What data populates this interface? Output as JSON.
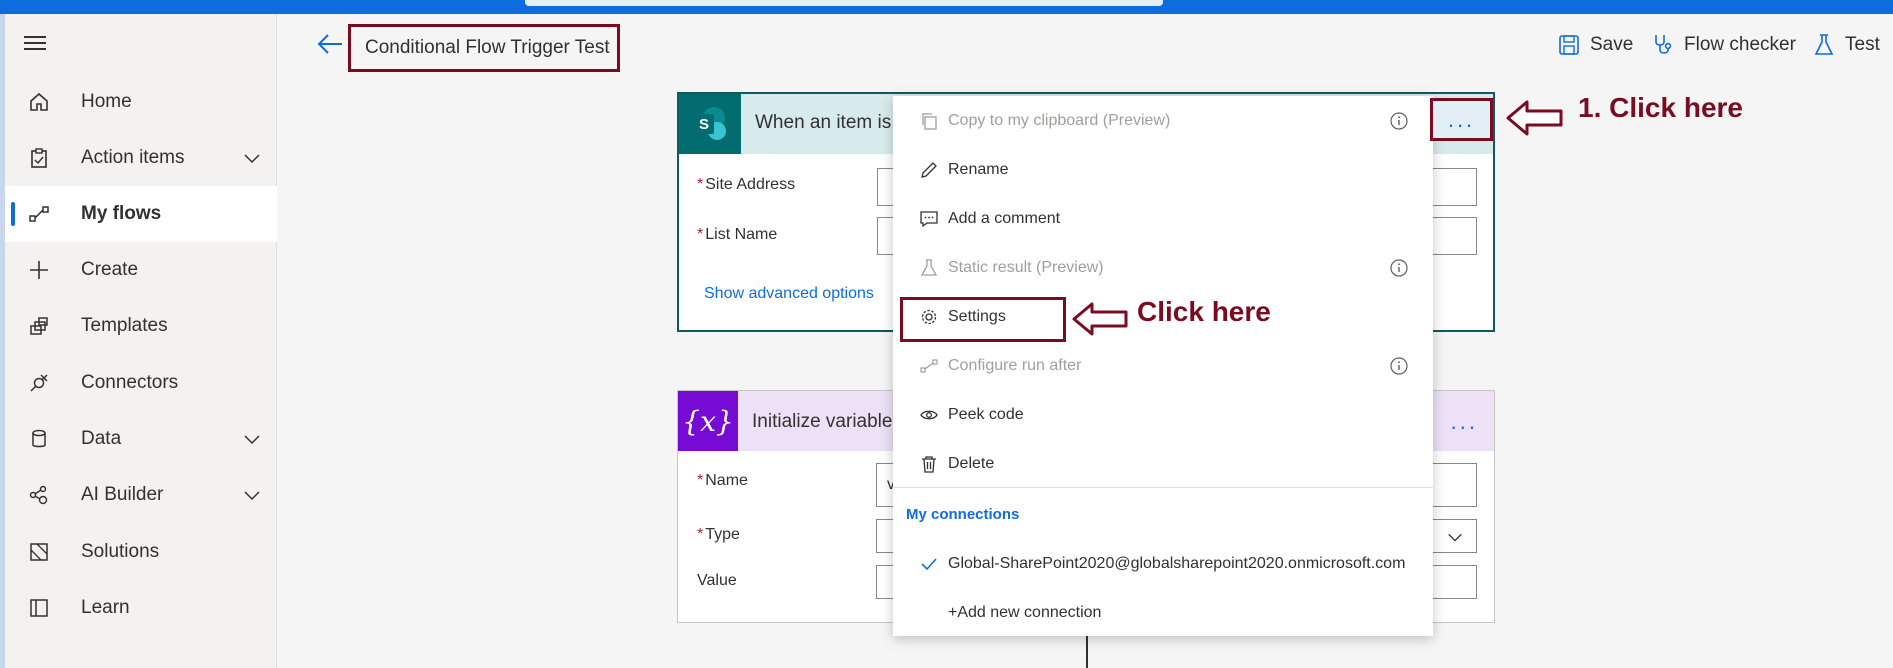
{
  "app": {
    "flow_title": "Conditional Flow Trigger Test"
  },
  "colors": {
    "brand_blue": "#0f6cdd",
    "annotation": "#7a0b20",
    "sharepoint_teal": "#036c70",
    "variable_purple": "#770bd6"
  },
  "sidebar": {
    "items": [
      {
        "label": "Home",
        "icon": "home-icon",
        "expandable": false
      },
      {
        "label": "Action items",
        "icon": "clipboard-icon",
        "expandable": true
      },
      {
        "label": "My flows",
        "icon": "flow-icon",
        "expandable": false,
        "active": true
      },
      {
        "label": "Create",
        "icon": "plus-icon",
        "expandable": false
      },
      {
        "label": "Templates",
        "icon": "templates-icon",
        "expandable": false
      },
      {
        "label": "Connectors",
        "icon": "plug-icon",
        "expandable": false
      },
      {
        "label": "Data",
        "icon": "database-icon",
        "expandable": true
      },
      {
        "label": "AI Builder",
        "icon": "ai-builder-icon",
        "expandable": true
      },
      {
        "label": "Solutions",
        "icon": "solutions-icon",
        "expandable": false
      },
      {
        "label": "Learn",
        "icon": "book-icon",
        "expandable": false
      }
    ]
  },
  "commandbar": {
    "save_label": "Save",
    "flow_checker_label": "Flow checker",
    "test_label": "Test"
  },
  "trigger_card": {
    "title": "When an item is",
    "fields": [
      {
        "label": "Site Address",
        "required": true
      },
      {
        "label": "List Name",
        "required": true
      }
    ],
    "advanced_link": "Show advanced options"
  },
  "variable_card": {
    "title": "Initialize variable",
    "dots": "...",
    "fields": [
      {
        "label": "Name",
        "required": true,
        "value": "v"
      },
      {
        "label": "Type",
        "required": true
      },
      {
        "label": "Value",
        "required": false
      }
    ]
  },
  "context_menu": {
    "items": [
      {
        "label": "Copy to my clipboard (Preview)",
        "disabled": true,
        "info": true
      },
      {
        "label": "Rename",
        "disabled": false,
        "info": false
      },
      {
        "label": "Add a comment",
        "disabled": false,
        "info": false
      },
      {
        "label": "Static result (Preview)",
        "disabled": true,
        "info": true
      },
      {
        "label": "Settings",
        "disabled": false,
        "info": false
      },
      {
        "label": "Configure run after",
        "disabled": true,
        "info": true
      },
      {
        "label": "Peek code",
        "disabled": false,
        "info": false
      },
      {
        "label": "Delete",
        "disabled": false,
        "info": false
      }
    ],
    "section_title": "My connections",
    "connection": "Global-SharePoint2020@globalsharepoint2020.onmicrosoft.com",
    "add_connection": "+Add new connection"
  },
  "annotations": {
    "step1": "1. Click here",
    "step2": "Click here"
  },
  "trigger_dots": "..."
}
